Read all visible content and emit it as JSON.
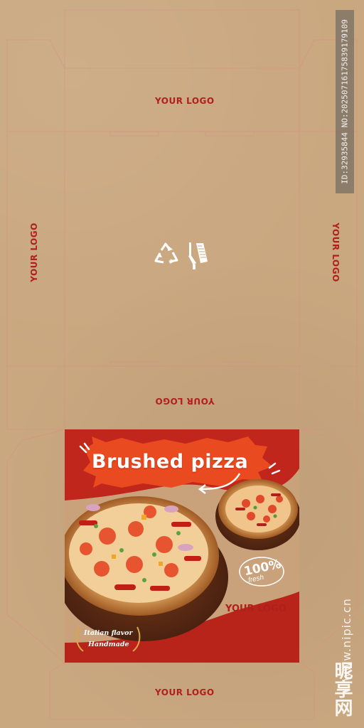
{
  "box": {
    "logo_top": "YOUR LOGO",
    "logo_left": "YOUR LOGO",
    "logo_right": "YOUR LOGO",
    "logo_inner_flipped": "YOUR LOGO",
    "logo_bottom": "YOUR LOGO",
    "icons": [
      "recycle-icon",
      "knife-icon"
    ],
    "colors": {
      "kraft": "#c9a77f",
      "logo_red": "#b0201a",
      "dieline": "#d98880"
    }
  },
  "panel": {
    "headline": "Brushed pizza",
    "fresh_number": "100%",
    "fresh_word": "fresh",
    "logo": "YOUR LOGO",
    "badge_line1": "Italian flavor",
    "badge_line2": "Handmade",
    "colors": {
      "red": "#c0261b",
      "orange": "#e9431e"
    }
  },
  "watermark": {
    "id_text": "ID:32935844 NO:20250716175839179109",
    "site": "www.nipic.cn",
    "brand": "昵享网"
  }
}
